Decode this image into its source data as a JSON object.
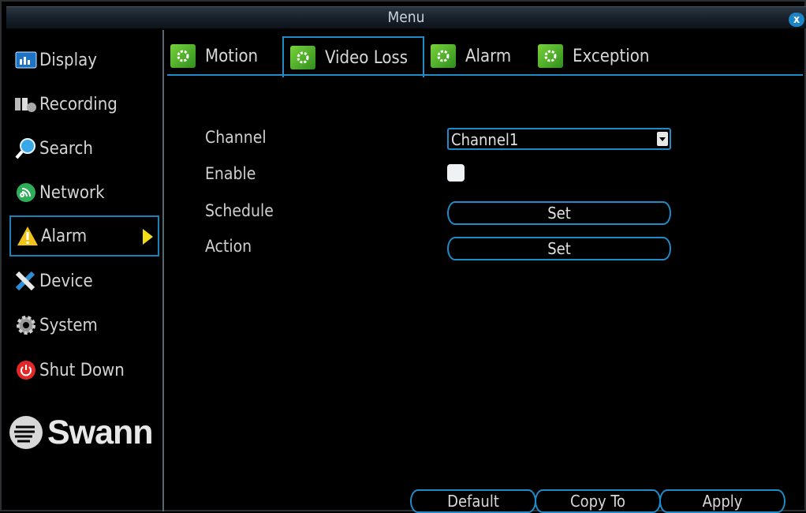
{
  "window": {
    "title": "Menu",
    "close": "x"
  },
  "sidebar": {
    "items": [
      {
        "label": "Display",
        "icon": "display-icon"
      },
      {
        "label": "Recording",
        "icon": "recording-icon"
      },
      {
        "label": "Search",
        "icon": "search-icon"
      },
      {
        "label": "Network",
        "icon": "network-icon"
      },
      {
        "label": "Alarm",
        "icon": "warning-icon",
        "active": true
      },
      {
        "label": "Device",
        "icon": "tools-icon"
      },
      {
        "label": "System",
        "icon": "gear-icon"
      },
      {
        "label": "Shut Down",
        "icon": "power-icon"
      }
    ],
    "logo": "Swann"
  },
  "tabs": [
    {
      "label": "Motion"
    },
    {
      "label": "Video Loss",
      "active": true
    },
    {
      "label": "Alarm"
    },
    {
      "label": "Exception"
    }
  ],
  "form": {
    "channel_label": "Channel",
    "channel_value": "Channel1",
    "enable_label": "Enable",
    "enable_checked": false,
    "schedule_label": "Schedule",
    "schedule_button": "Set",
    "action_label": "Action",
    "action_button": "Set"
  },
  "footer": {
    "default": "Default",
    "copy_to": "Copy To",
    "apply": "Apply"
  },
  "colors": {
    "accent": "#1f8bc8",
    "highlight": "#f2dc1a",
    "background": "#000000"
  }
}
